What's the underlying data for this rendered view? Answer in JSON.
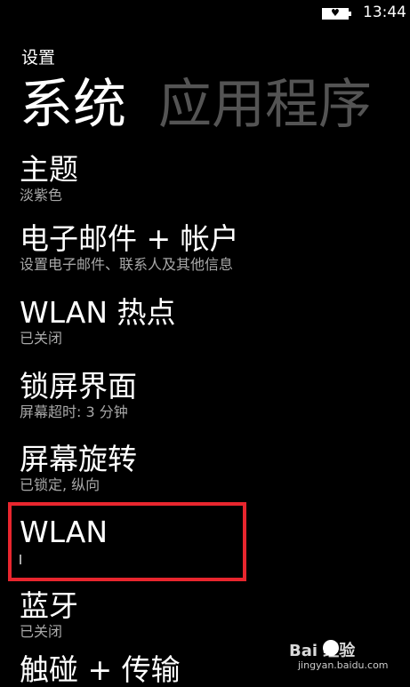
{
  "status_bar": {
    "time": "13:44",
    "battery_icon": "battery-saver-heart-icon"
  },
  "header": {
    "breadcrumb": "设置",
    "tabs": [
      {
        "label": "系统",
        "active": true
      },
      {
        "label": "应用程序",
        "active": false
      }
    ]
  },
  "settings": {
    "items": [
      {
        "title": "主题",
        "subtitle": "淡紫色"
      },
      {
        "title": "电子邮件 + 帐户",
        "subtitle": "设置电子邮件、联系人及其他信息"
      },
      {
        "title": "WLAN 热点",
        "subtitle": "已关闭"
      },
      {
        "title": "锁屏界面",
        "subtitle": "屏幕超时: 3 分钟"
      },
      {
        "title": "屏幕旋转",
        "subtitle": "已锁定, 纵向"
      },
      {
        "title": "WLAN",
        "subtitle": ""
      },
      {
        "title": "蓝牙",
        "subtitle": "已关闭"
      },
      {
        "title": "触碰 + 传输",
        "subtitle": ""
      }
    ]
  },
  "highlight_color": "#e8262e",
  "watermark": {
    "brand": "Bai  经验",
    "url": "jingyan.baidu.com"
  }
}
